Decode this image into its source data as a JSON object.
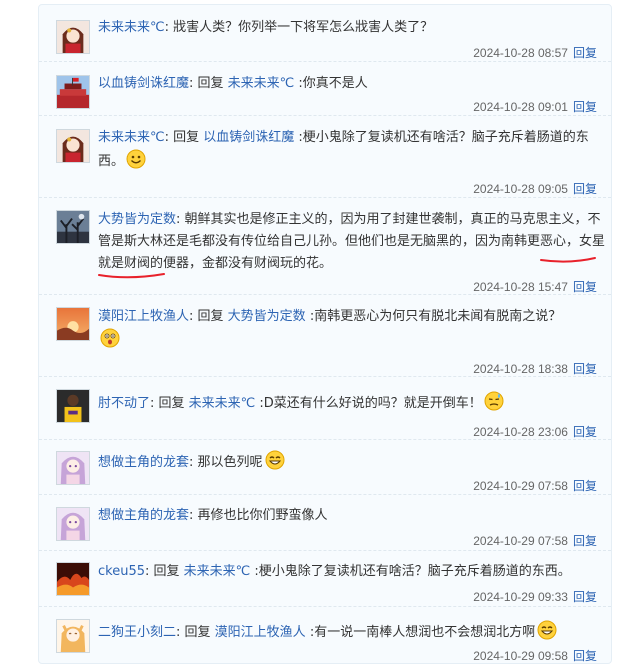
{
  "replies": [
    {
      "user": "未来未来℃",
      "sep": ": ",
      "reply_word": "",
      "target": "",
      "content": "戕害人类？你列举一下将军怎么戕害人类了？",
      "time": "2024-10-28 08:57",
      "reply_btn": "回复",
      "avatar": "anime-girl-red"
    },
    {
      "user": "以血铸剑诛红魔",
      "sep": ": ",
      "reply_word": "回复 ",
      "target": "未来未来℃",
      "content": " :你真不是人",
      "time": "2024-10-28 09:01",
      "reply_btn": "回复",
      "avatar": "red-flag-building"
    },
    {
      "user": "未来未来℃",
      "sep": ": ",
      "reply_word": "回复 ",
      "target": "以血铸剑诛红魔",
      "content": " :梗小鬼除了复读机还有啥活？脑子充斥着肠道的东西。",
      "time": "2024-10-28 09:05",
      "reply_btn": "回复",
      "avatar": "anime-girl-red",
      "emoji": "smile"
    },
    {
      "user": "大势皆为定数",
      "sep": ": ",
      "reply_word": "",
      "target": "",
      "content": "朝鲜其实也是修正主义的，因为用了封建世袭制，真正的马克思主义，不管是斯大林还是毛都没有传位给自己儿孙。但他们也是无脑黑的，因为南韩更恶心，女星就是财阀的便器，金都没有财阀玩的花。",
      "time": "2024-10-28 15:47",
      "reply_btn": "回复",
      "avatar": "dark-tree"
    },
    {
      "user": "漠阳江上牧渔人",
      "sep": ": ",
      "reply_word": "回复 ",
      "target": "大势皆为定数",
      "content": " :南韩更恶心为何只有脱北未闻有脱南之说？",
      "time": "2024-10-28 18:38",
      "reply_btn": "回复",
      "avatar": "sunset",
      "emoji": "surprised"
    },
    {
      "user": "肘不动了",
      "sep": ": ",
      "reply_word": "回复 ",
      "target": "未来未来℃",
      "content": " :D菜还有什么好说的吗？就是开倒车！",
      "time": "2024-10-28 23:06",
      "reply_btn": "回复",
      "avatar": "basketball-player",
      "emoji": "sweat"
    },
    {
      "user": "想做主角的龙套",
      "sep": ": ",
      "reply_word": "",
      "target": "",
      "content": "那以色列呢",
      "time": "2024-10-29 07:58",
      "reply_btn": "回复",
      "avatar": "anime-girl-purple",
      "emoji": "grin"
    },
    {
      "user": "想做主角的龙套",
      "sep": ": ",
      "reply_word": "",
      "target": "",
      "content": "再修也比你们野蛮像人",
      "time": "2024-10-29 07:58",
      "reply_btn": "回复",
      "avatar": "anime-girl-purple"
    },
    {
      "user": "ckeu55",
      "sep": ": ",
      "reply_word": "回复 ",
      "target": "未来未来℃",
      "content": " :梗小鬼除了复读机还有啥活？脑子充斥着肠道的东西。",
      "time": "2024-10-29 09:33",
      "reply_btn": "回复",
      "avatar": "fire-landscape"
    },
    {
      "user": "二狗王小刻二",
      "sep": ": ",
      "reply_word": "回复 ",
      "target": "漠阳江上牧渔人",
      "content": " :有一说一南棒人想润也不会想润北方啊",
      "time": "2024-10-29 09:58",
      "reply_btn": "回复",
      "avatar": "anime-girl-orange",
      "emoji": "grin"
    }
  ],
  "colors": {
    "username": "#2d64b3",
    "text": "#333333",
    "time": "#666666",
    "annotation": "#e8212b",
    "background": "#f7fbfe"
  }
}
